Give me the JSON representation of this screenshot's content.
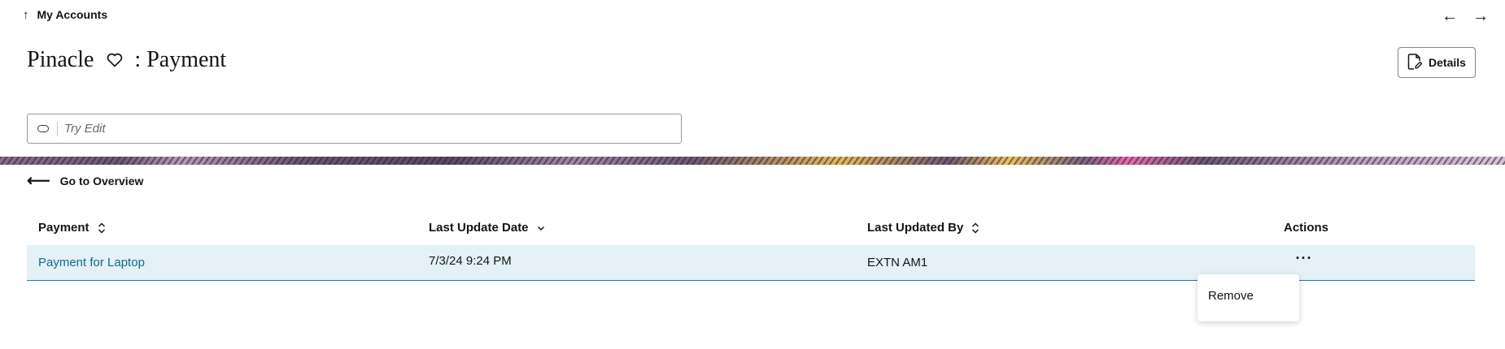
{
  "topbar": {
    "back_label": "My Accounts",
    "back_icon": "arrow-up-icon",
    "nav_prev_icon": "arrow-left-icon",
    "nav_next_icon": "arrow-right-icon"
  },
  "header": {
    "title_main": "Pinacle",
    "title_suffix": ": Payment",
    "favorite_icon": "heart-icon",
    "details_label": "Details",
    "details_icon": "document-edit-icon"
  },
  "search": {
    "placeholder": "Try Edit",
    "value": ""
  },
  "overview": {
    "label": "Go to Overview",
    "icon": "arrow-left-icon"
  },
  "table": {
    "columns": [
      {
        "label": "Payment",
        "sort": "both"
      },
      {
        "label": "Last Update Date",
        "sort": "descending"
      },
      {
        "label": "Last Updated By",
        "sort": "both"
      },
      {
        "label": "Actions",
        "sort": "none"
      }
    ],
    "rows": [
      {
        "payment": "Payment for Laptop",
        "last_update_date": "7/3/24 9:24 PM",
        "last_updated_by": "EXTN AM1",
        "actions_icon": "more-horizontal-icon"
      }
    ]
  },
  "actions_menu": {
    "items": [
      "Remove"
    ]
  },
  "colors": {
    "link": "#0f6b8d",
    "row_selected_bg": "#e4f1f7",
    "row_border": "#227e9e",
    "text": "#161513"
  }
}
